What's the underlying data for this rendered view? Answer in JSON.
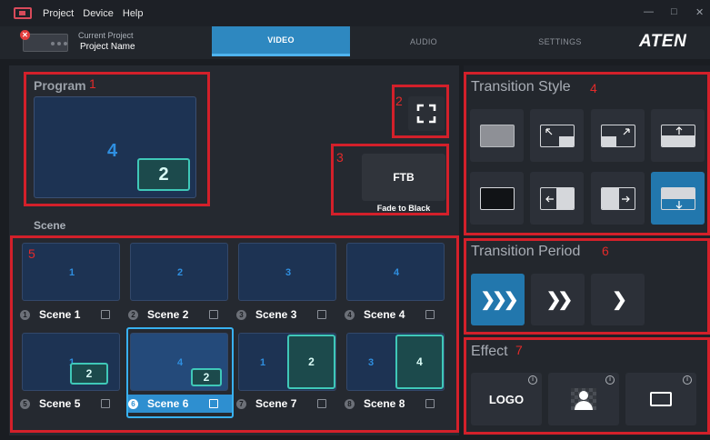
{
  "menubar": {
    "items": [
      "Project",
      "Device",
      "Help"
    ],
    "minimize": "—",
    "maximize": "□",
    "close": "✕"
  },
  "header": {
    "project_label": "Current Project",
    "project_name": "Project Name",
    "error_badge": "✕",
    "tabs": [
      "VIDEO",
      "AUDIO",
      "SETTINGS"
    ],
    "active_tab": "VIDEO",
    "logo": "ATEN"
  },
  "program": {
    "title": "Program",
    "main_source": "4",
    "pip_source": "2"
  },
  "ftb": {
    "label": "FTB",
    "caption": "Fade to Black"
  },
  "scene_section": {
    "title": "Scene"
  },
  "scenes": [
    {
      "badge": "1",
      "name": "Scene 1",
      "main": "1"
    },
    {
      "badge": "2",
      "name": "Scene 2",
      "main": "2"
    },
    {
      "badge": "3",
      "name": "Scene 3",
      "main": "3"
    },
    {
      "badge": "4",
      "name": "Scene 4",
      "main": "4"
    },
    {
      "badge": "5",
      "name": "Scene 5",
      "main": "1",
      "pip": "2"
    },
    {
      "badge": "6",
      "name": "Scene 6",
      "main": "4",
      "pip": "2"
    },
    {
      "badge": "7",
      "name": "Scene 7",
      "main": "1",
      "pip": "2"
    },
    {
      "badge": "8",
      "name": "Scene 8",
      "main": "3",
      "pip": "4"
    }
  ],
  "selected_scene": "Scene 6",
  "transition_style": {
    "title": "Transition Style",
    "icons": [
      "cut-gray-icon",
      "pip-top-left-icon",
      "pip-top-right-icon",
      "slide-up-icon",
      "black-icon",
      "wipe-left-icon",
      "wipe-right-icon",
      "slide-down-icon"
    ],
    "selected": "slide-down-icon"
  },
  "transition_period": {
    "title": "Transition Period",
    "buttons": [
      "❯❯❯",
      "❯❯",
      "❯"
    ],
    "selected": "fast"
  },
  "effect": {
    "title": "Effect",
    "logo_label": "LOGO",
    "info": "i"
  },
  "annotations": [
    "1",
    "2",
    "3",
    "4",
    "5",
    "6",
    "7"
  ],
  "colors": {
    "accent": "#2e88c0",
    "highlight": "#d3202a",
    "pip_border": "#3fc8b8"
  }
}
